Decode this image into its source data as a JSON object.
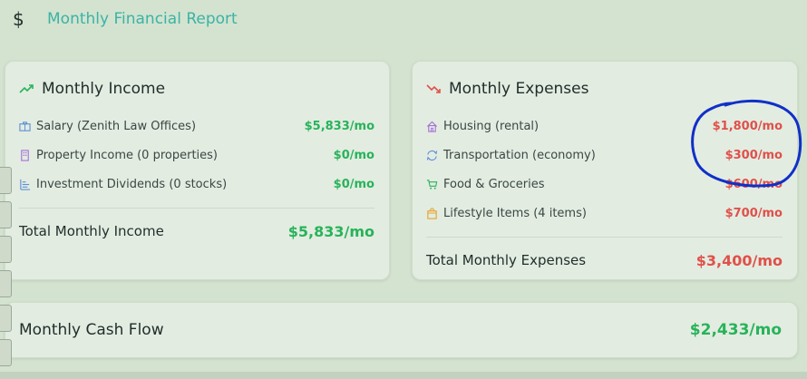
{
  "header": {
    "icon": "dollar-icon",
    "title": "Monthly Financial Report"
  },
  "income": {
    "title": "Monthly Income",
    "items": [
      {
        "icon": "briefcase-icon",
        "label": "Salary (Zenith Law Offices)",
        "value": "$5,833/mo"
      },
      {
        "icon": "building-icon",
        "label": "Property Income (0 properties)",
        "value": "$0/mo"
      },
      {
        "icon": "bar-chart-icon",
        "label": "Investment Dividends (0 stocks)",
        "value": "$0/mo"
      }
    ],
    "total_label": "Total Monthly Income",
    "total_value": "$5,833/mo"
  },
  "expenses": {
    "title": "Monthly Expenses",
    "items": [
      {
        "icon": "house-icon",
        "label": "Housing (rental)",
        "value": "$1,800/mo"
      },
      {
        "icon": "refresh-icon",
        "label": "Transportation (economy)",
        "value": "$300/mo"
      },
      {
        "icon": "cart-icon",
        "label": "Food & Groceries",
        "value": "$600/mo"
      },
      {
        "icon": "shopping-bag-icon",
        "label": "Lifestyle Items (4 items)",
        "value": "$700/mo"
      }
    ],
    "total_label": "Total Monthly Expenses",
    "total_value": "$3,400/mo"
  },
  "cashflow": {
    "label": "Monthly Cash Flow",
    "value": "$2,433/mo"
  },
  "colors": {
    "accent": "#3bb3a6",
    "positive": "#27b35a",
    "negative": "#e0504a",
    "background": "#d3e3cf",
    "card": "#e3ece1",
    "annotation": "#1030c8"
  }
}
